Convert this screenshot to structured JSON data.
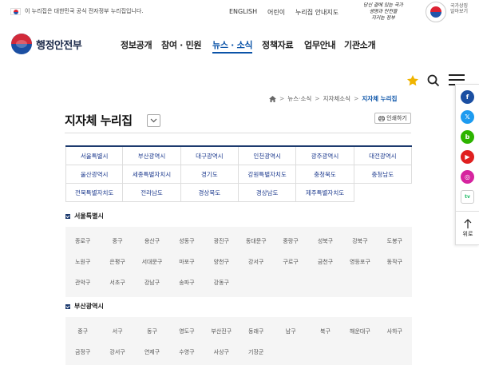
{
  "gov_banner": {
    "notice": "이 누리집은 대한민국 공식 전자정부 누리집입니다.",
    "links": [
      "ENGLISH",
      "어린이",
      "누리집 안내지도"
    ],
    "slogan": "당신 곁에 있는 국가, 생명과 안전을 지키는 정부"
  },
  "header": {
    "logo_text": "행정안전부",
    "nav": [
      "정보공개",
      "참여 · 민원",
      "뉴스 · 소식",
      "정책자료",
      "업무안내",
      "기관소개"
    ],
    "active_nav": "뉴스 · 소식"
  },
  "breadcrumb": [
    "뉴스·소식",
    "지자체소식",
    "지자체 누리집"
  ],
  "page": {
    "title": "지자체 누리집",
    "print_label": "인쇄하기"
  },
  "regions": [
    "서울특별시",
    "부산광역시",
    "대구광역시",
    "인천광역시",
    "광주광역시",
    "대전광역시",
    "울산광역시",
    "세종특별자치시",
    "경기도",
    "강원특별자치도",
    "충청북도",
    "충청남도",
    "전북특별자치도",
    "전라남도",
    "경상북도",
    "경상남도",
    "제주특별자치도"
  ],
  "sections": [
    {
      "name": "서울특별시",
      "districts": [
        "종로구",
        "중구",
        "용산구",
        "성동구",
        "광진구",
        "동대문구",
        "중랑구",
        "성북구",
        "강북구",
        "도봉구",
        "노원구",
        "은평구",
        "서대문구",
        "마포구",
        "양천구",
        "강서구",
        "구로구",
        "금천구",
        "영등포구",
        "동작구",
        "관악구",
        "서초구",
        "강남구",
        "송파구",
        "강동구"
      ]
    },
    {
      "name": "부산광역시",
      "districts": [
        "중구",
        "서구",
        "동구",
        "영도구",
        "부산진구",
        "동래구",
        "남구",
        "북구",
        "해운대구",
        "사하구",
        "금정구",
        "강서구",
        "연제구",
        "수영구",
        "사상구",
        "기장군"
      ]
    }
  ],
  "social": {
    "items": [
      {
        "name": "facebook",
        "glyph": "f",
        "color": "#1b4fa2"
      },
      {
        "name": "x",
        "glyph": "𝕏",
        "color": "#1d9bf0"
      },
      {
        "name": "blog",
        "glyph": "b",
        "color": "#2db400"
      },
      {
        "name": "youtube",
        "glyph": "▶",
        "color": "#e02020"
      },
      {
        "name": "instagram",
        "glyph": "◎",
        "color": "#d6249f"
      },
      {
        "name": "kakao-tv",
        "glyph": "tv",
        "color": "#ffffff"
      }
    ],
    "top_label": "위로"
  },
  "colors": {
    "accent": "#0a53a8",
    "grid_border": "#1c3a6e",
    "star": "#f0b400"
  }
}
